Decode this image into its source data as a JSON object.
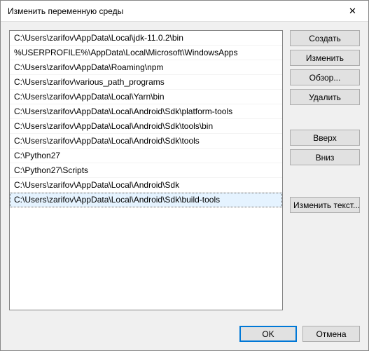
{
  "window": {
    "title": "Изменить переменную среды"
  },
  "list": {
    "items": [
      "C:\\Users\\zarifov\\AppData\\Local\\jdk-11.0.2\\bin",
      "%USERPROFILE%\\AppData\\Local\\Microsoft\\WindowsApps",
      "C:\\Users\\zarifov\\AppData\\Roaming\\npm",
      "C:\\Users\\zarifov\\various_path_programs",
      "C:\\Users\\zarifov\\AppData\\Local\\Yarn\\bin",
      "C:\\Users\\zarifov\\AppData\\Local\\Android\\Sdk\\platform-tools",
      "C:\\Users\\zarifov\\AppData\\Local\\Android\\Sdk\\tools\\bin",
      "C:\\Users\\zarifov\\AppData\\Local\\Android\\Sdk\\tools",
      "C:\\Python27",
      "C:\\Python27\\Scripts",
      "C:\\Users\\zarifov\\AppData\\Local\\Android\\Sdk",
      "C:\\Users\\zarifov\\AppData\\Local\\Android\\Sdk\\build-tools"
    ],
    "selected_index": 11
  },
  "buttons": {
    "create": "Создать",
    "edit": "Изменить",
    "browse": "Обзор...",
    "delete": "Удалить",
    "up": "Вверх",
    "down": "Вниз",
    "edit_text": "Изменить текст...",
    "ok": "OK",
    "cancel": "Отмена"
  }
}
